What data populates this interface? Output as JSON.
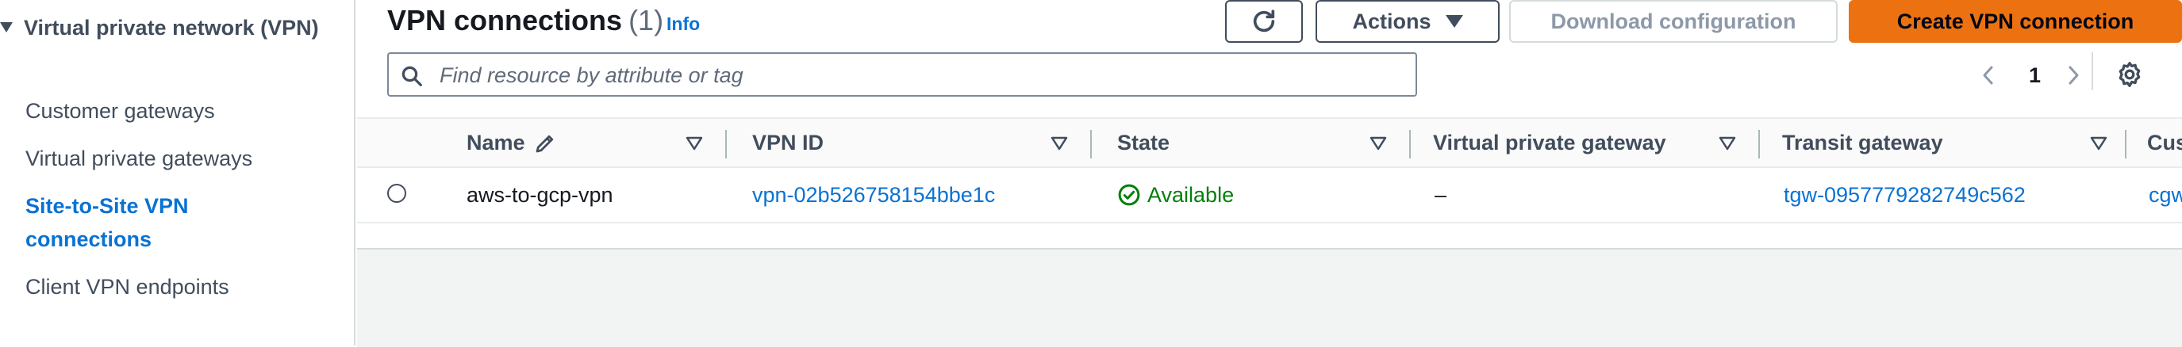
{
  "sidebar": {
    "section_label": "Virtual private network (VPN)",
    "items": [
      {
        "label": "Customer gateways",
        "active": false
      },
      {
        "label": "Virtual private gateways",
        "active": false
      },
      {
        "label": "Site-to-Site VPN connections",
        "active": true
      },
      {
        "label": "Client VPN endpoints",
        "active": false
      }
    ]
  },
  "header": {
    "title": "VPN connections",
    "count": "(1)",
    "info": "Info"
  },
  "toolbar": {
    "actions_label": "Actions",
    "download_label": "Download configuration",
    "create_label": "Create VPN connection"
  },
  "search": {
    "placeholder": "Find resource by attribute or tag",
    "value": ""
  },
  "pagination": {
    "current_page": "1"
  },
  "table": {
    "columns": [
      "Name",
      "VPN ID",
      "State",
      "Virtual private gateway",
      "Transit gateway",
      "Cus"
    ],
    "rows": [
      {
        "name": "aws-to-gcp-vpn",
        "vpn_id": "vpn-02b526758154bbe1c",
        "state": "Available",
        "virtual_private_gateway": "–",
        "transit_gateway": "tgw-0957779282749c562",
        "customer_gateway": "cgw"
      }
    ]
  },
  "colors": {
    "accent": "#0972d3",
    "primary_button": "#ec7211",
    "success": "#037f0c",
    "text": "#16191f",
    "muted": "#5f6b7a"
  }
}
